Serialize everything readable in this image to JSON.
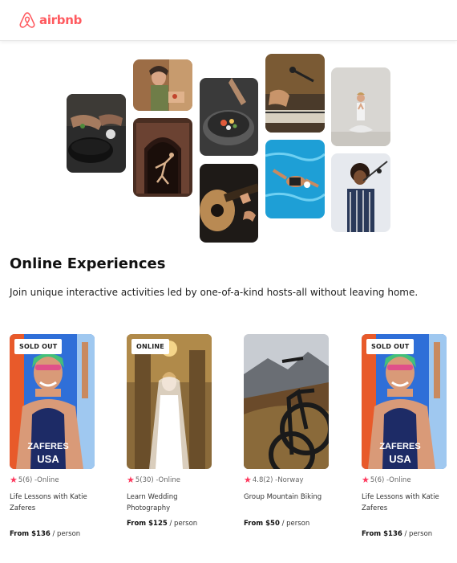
{
  "brand": {
    "name": "airbnb",
    "color": "#FF5A5F"
  },
  "section": {
    "title": "Online Experiences",
    "subtitle": "Join unique interactive activities led by one-of-a-kind hosts-all without leaving home."
  },
  "accent": {
    "star_color": "#FE385D"
  },
  "cards": [
    {
      "badge": "SOLD OUT",
      "rating": "5",
      "reviews": "(6)",
      "location": "Online",
      "title": "Life Lessons with Katie Zaferes",
      "price_label": "From $136",
      "unit": "/ person"
    },
    {
      "badge": "ONLINE",
      "rating": "5",
      "reviews": "(30)",
      "location": "Online",
      "title": "Learn Wedding Photography",
      "price_label": "From $125",
      "unit": "/ person"
    },
    {
      "badge": "",
      "rating": "4.8",
      "reviews": "(2)",
      "location": "Norway",
      "title": "Group Mountain Biking",
      "price_label": "From $50",
      "unit": "/ person"
    },
    {
      "badge": "SOLD OUT",
      "rating": "5",
      "reviews": "(6)",
      "location": "Online",
      "title": "Life Lessons with Katie Zaferes",
      "price_label": "From $136",
      "unit": "/ person"
    }
  ],
  "swimmer_suit_text": {
    "line1": "ZAFERES",
    "line2": "USA"
  },
  "icons": {
    "logo": "airbnb-logo-icon",
    "rating": "star-icon"
  }
}
